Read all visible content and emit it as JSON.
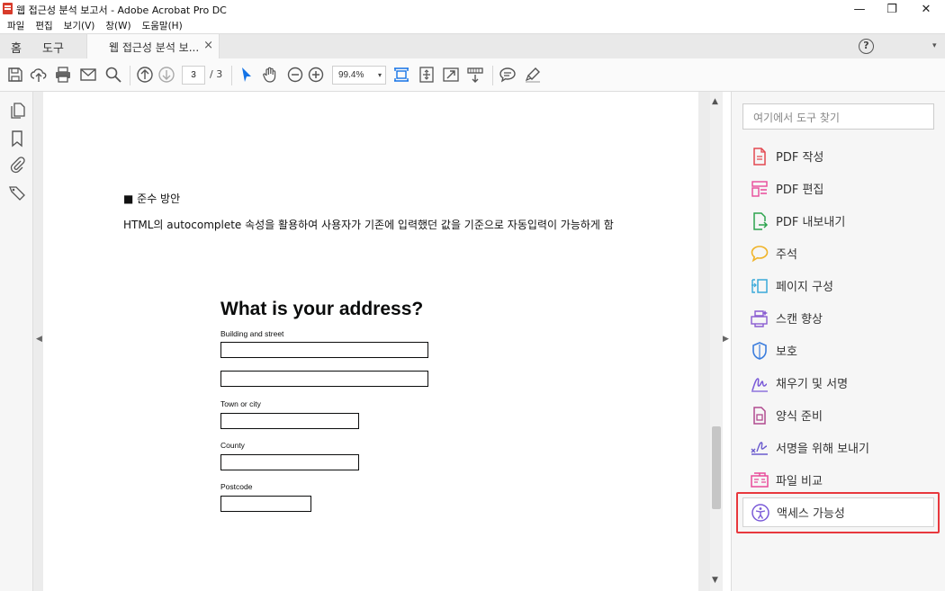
{
  "window": {
    "title": "웹 접근성 분석 보고서 - Adobe Acrobat Pro DC",
    "minimize": "—",
    "restore": "❐",
    "close": "✕"
  },
  "menu": [
    "파일",
    "편집",
    "보기(V)",
    "창(W)",
    "도움말(H)"
  ],
  "tabs": {
    "home": "홈",
    "tools": "도구",
    "document": "웹 접근성 분석 보...",
    "close": "×",
    "help": "?",
    "dropdown": "▾"
  },
  "toolbar": {
    "current_page": "3",
    "total_pages": "/ 3",
    "zoom": "99.4%",
    "zoom_arrow": "▾"
  },
  "document": {
    "heading": "■  준수 방안",
    "body": "HTML의 autocomplete 속성을 활용하여 사용자가 기존에 입력했던 값을 기준으로 자동입력이 가능하게 함",
    "form": {
      "title": "What is your address?",
      "labels": [
        "Building and street",
        "Town or city",
        "County",
        "Postcode"
      ]
    }
  },
  "scroll": {
    "up": "▲",
    "down": "▼"
  },
  "collapse": {
    "left": "◀",
    "right": "▶"
  },
  "right_panel": {
    "search_placeholder": "여기에서 도구 찾기",
    "tools": [
      {
        "label": "PDF 작성",
        "icon": "create-pdf-icon",
        "color": "#e34850"
      },
      {
        "label": "PDF 편집",
        "icon": "edit-pdf-icon",
        "color": "#e84a9a"
      },
      {
        "label": "PDF 내보내기",
        "icon": "export-pdf-icon",
        "color": "#2da44e"
      },
      {
        "label": "주석",
        "icon": "comment-icon",
        "color": "#f0b429"
      },
      {
        "label": "페이지 구성",
        "icon": "organize-pages-icon",
        "color": "#38a9d9"
      },
      {
        "label": "스캔 향상",
        "icon": "scan-enhance-icon",
        "color": "#8a5cd1"
      },
      {
        "label": "보호",
        "icon": "protect-icon",
        "color": "#3b7ddd"
      },
      {
        "label": "채우기 및 서명",
        "icon": "fill-sign-icon",
        "color": "#7a5ad8"
      },
      {
        "label": "양식 준비",
        "icon": "prepare-form-icon",
        "color": "#b14a8f"
      },
      {
        "label": "서명을 위해 보내기",
        "icon": "send-for-signature-icon",
        "color": "#6a5acd"
      },
      {
        "label": "파일 비교",
        "icon": "compare-files-icon",
        "color": "#e84a9a"
      },
      {
        "label": "액세스 가능성",
        "icon": "accessibility-icon",
        "color": "#7a5ad8"
      }
    ]
  }
}
